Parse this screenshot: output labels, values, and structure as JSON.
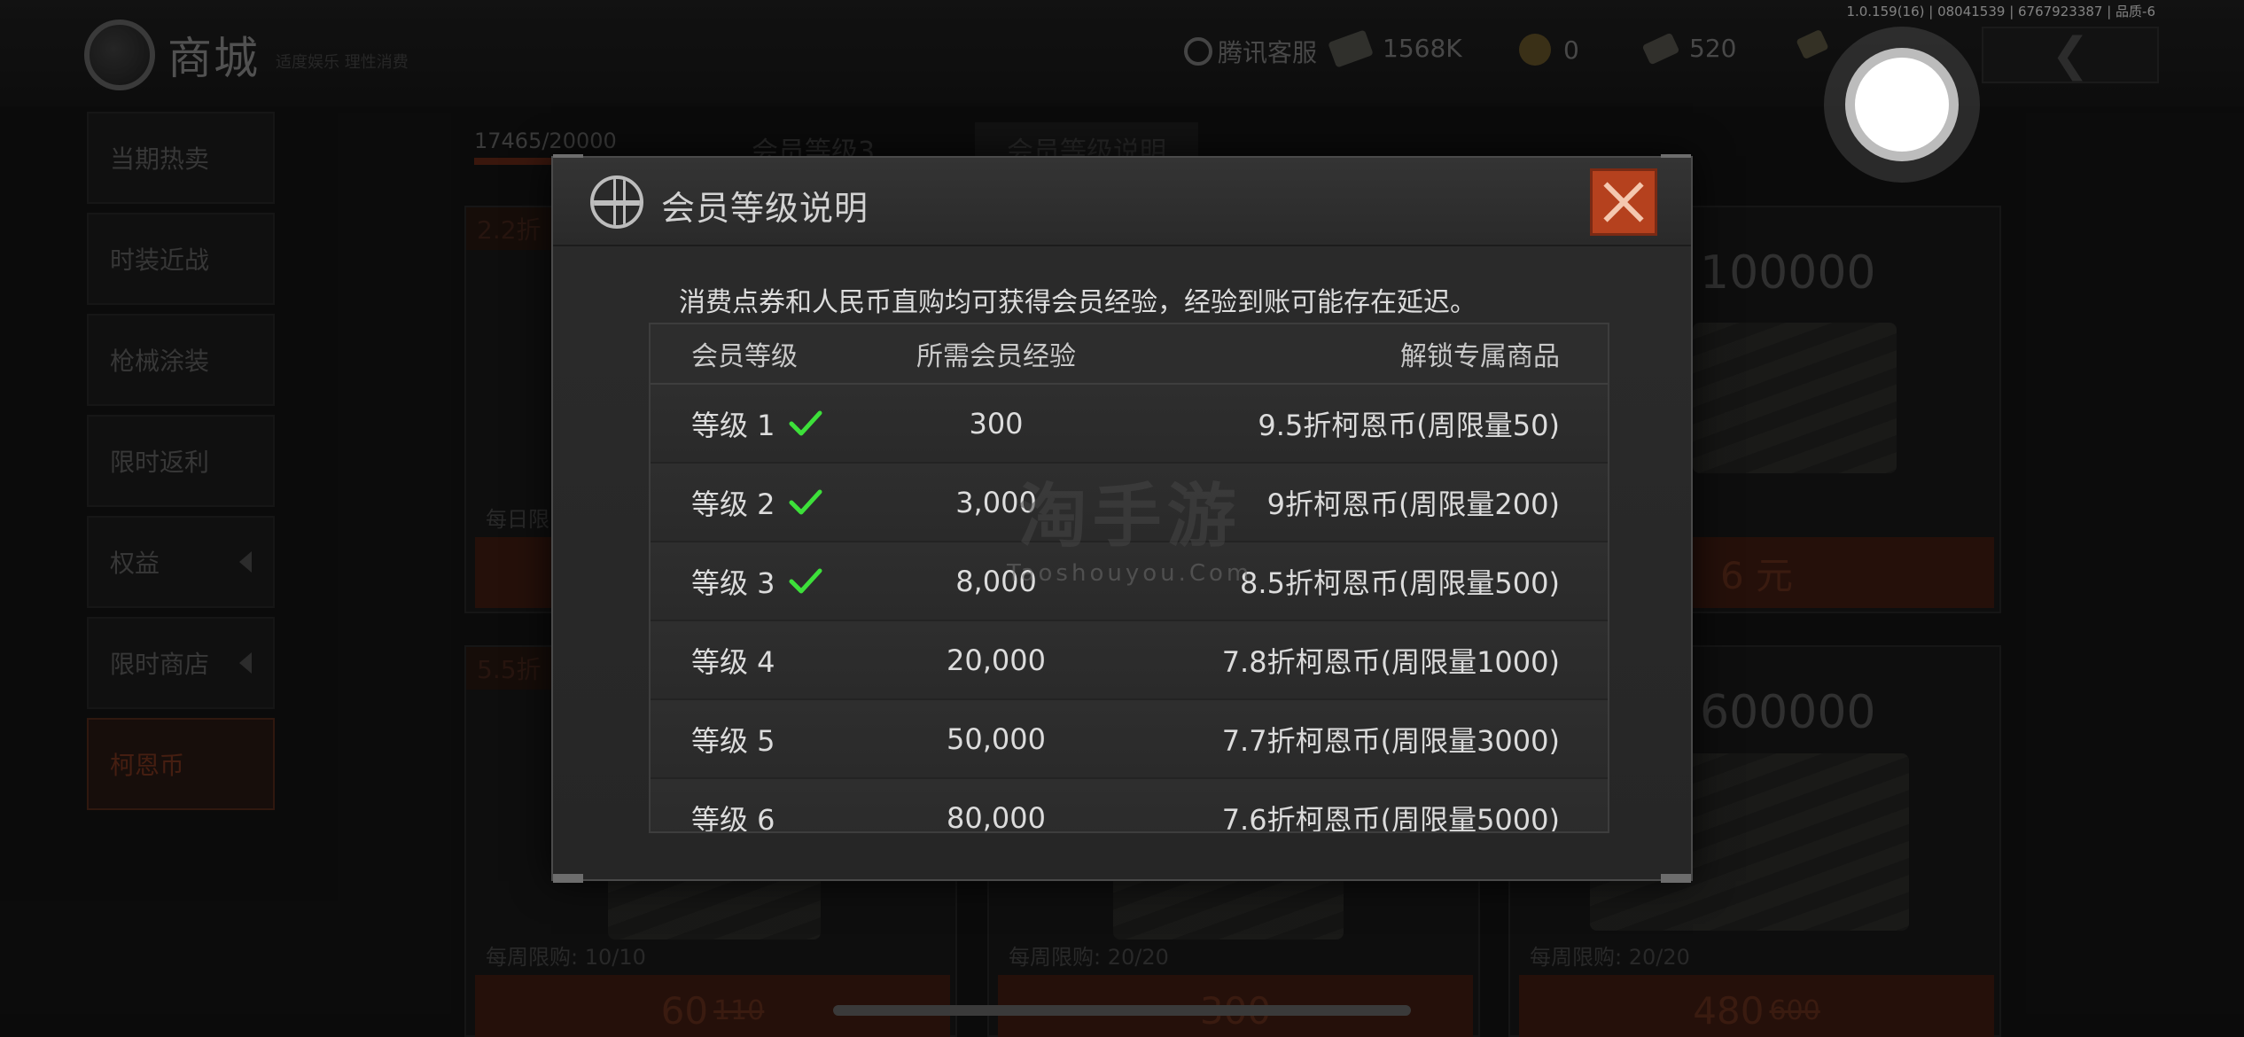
{
  "status": {
    "version_text": "1.0.159(16) | 08041539 | 6767923387 | 品质-6"
  },
  "shop": {
    "title": "商城",
    "subtitle": "适度娱乐 理性消费",
    "service_label": "腾讯客服",
    "currencies": [
      {
        "icon": "cash-icon",
        "value": "1568K"
      },
      {
        "icon": "coin-icon",
        "value": "0"
      },
      {
        "icon": "ticket-icon",
        "value": "520"
      },
      {
        "icon": "card-icon",
        "value": ""
      }
    ],
    "side_menu": [
      {
        "label": "当期热卖",
        "has_arrow": false,
        "active": false
      },
      {
        "label": "时装近战",
        "has_arrow": false,
        "active": false
      },
      {
        "label": "枪械涂装",
        "has_arrow": false,
        "active": false
      },
      {
        "label": "限时返利",
        "has_arrow": false,
        "active": false
      },
      {
        "label": "权益",
        "has_arrow": true,
        "active": false
      },
      {
        "label": "限时商店",
        "has_arrow": true,
        "active": false
      },
      {
        "label": "柯恩币",
        "has_arrow": false,
        "active": true
      }
    ],
    "member_progress": "17465/20000",
    "member_progress_fraction": 0.873,
    "member_level_tab": "会员等级3",
    "member_info_tab": "会员等级说明",
    "cards": [
      {
        "discount": "2.2折",
        "amount": "",
        "limit": "每日限",
        "price": ""
      },
      {
        "discount": "",
        "amount": "100000",
        "limit": "",
        "price": "6 元"
      },
      {
        "discount": "5.5折",
        "amount": "",
        "limit": "每周限购: 10/10",
        "price": "60",
        "old_price": "110"
      },
      {
        "discount": "",
        "amount": "",
        "limit": "每周限购: 20/20",
        "price": "300",
        "old_price": ""
      },
      {
        "discount": "",
        "amount": "600000",
        "limit": "每周限购: 20/20",
        "price": "480",
        "old_price": "600"
      }
    ]
  },
  "modal": {
    "title": "会员等级说明",
    "description": "消费点券和人民币直购均可获得会员经验，经验到账可能存在延迟。",
    "columns": [
      "会员等级",
      "所需会员经验",
      "解锁专属商品"
    ],
    "rows": [
      {
        "level": "等级 1",
        "exp": "300",
        "item": "9.5折柯恩币(周限量50)",
        "achieved": true
      },
      {
        "level": "等级 2",
        "exp": "3,000",
        "item": "9折柯恩币(周限量200)",
        "achieved": true
      },
      {
        "level": "等级 3",
        "exp": "8,000",
        "item": "8.5折柯恩币(周限量500)",
        "achieved": true
      },
      {
        "level": "等级 4",
        "exp": "20,000",
        "item": "7.8折柯恩币(周限量1000)",
        "achieved": false
      },
      {
        "level": "等级 5",
        "exp": "50,000",
        "item": "7.7折柯恩币(周限量3000)",
        "achieved": false
      },
      {
        "level": "等级 6",
        "exp": "80,000",
        "item": "7.6折柯恩币(周限量5000)",
        "achieved": false
      }
    ],
    "check_color": "#3de03a",
    "close_color": "#b5411e"
  },
  "watermark": {
    "main": "淘手游",
    "sub": "Taoshouyou.Com"
  }
}
